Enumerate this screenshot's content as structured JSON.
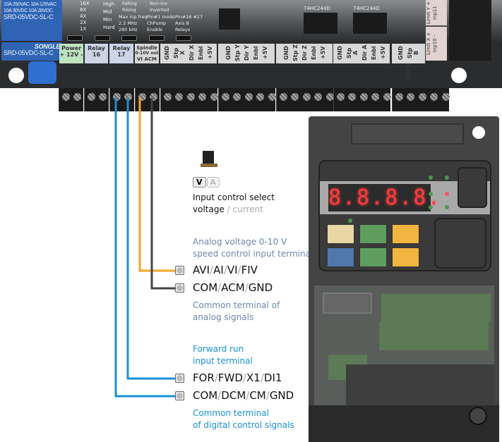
{
  "board": {
    "relay_text": [
      "10A 250VAC  10A 125VAC",
      "10A  30VDC  10A  28VDC",
      "SRD-05VDC-SL-C"
    ],
    "relay_brand": "SONGLE",
    "chip_labels": [
      "74HC244D",
      "74HC244D"
    ],
    "switch_groups": [
      {
        "items": [
          "16X",
          "8X",
          "4X",
          "2X",
          "1X"
        ]
      },
      {
        "items": [
          "High",
          "Mid",
          "Min",
          "Hard"
        ]
      },
      {
        "title": "Max inp freq",
        "items": [
          "Falling",
          "Rising",
          "2.2 MHz",
          "280 kHz"
        ]
      },
      {
        "title": "Pin#1 mode",
        "items": [
          "Non-inv",
          "Inverted",
          "ChPump",
          "Enable"
        ]
      },
      {
        "title": "Pin#16  #17",
        "items": [
          "Axis B",
          "Relays"
        ]
      }
    ],
    "connector_labels": [
      {
        "title": "Power",
        "sub": "+ 12V -"
      },
      {
        "title": "Relay",
        "sub": "16"
      },
      {
        "title": "Relay",
        "sub": "17"
      },
      {
        "title": "Spindle",
        "sub": "0-10V out",
        "sub2": "VI ACM"
      }
    ],
    "axis_groups": [
      [
        "GND",
        "Stp X",
        "Dir X",
        "Enbl",
        "+5V"
      ],
      [
        "GND",
        "Stp Y",
        "Dir Y",
        "Enbl",
        "+5V"
      ],
      [
        "GND",
        "Stp Z",
        "Dir Z",
        "Enbl",
        "+5V"
      ],
      [
        "GND",
        "Stp A",
        "Dir A",
        "Enbl",
        "+5V"
      ],
      [
        "GND",
        "Stp B",
        "Dir B"
      ]
    ],
    "limit_labels": [
      "Limit Y  + inp11",
      "Limit X  + inp10 -"
    ]
  },
  "jumper": {
    "options": [
      "V",
      "A"
    ],
    "selected": "V",
    "caption_line1": "Input control select",
    "caption_selected": "voltage",
    "caption_sep": " / ",
    "caption_other": "current"
  },
  "terminals": [
    {
      "parts": [
        "AVI",
        "AI",
        "VI",
        "FIV"
      ],
      "wire_color": "#f5a623"
    },
    {
      "parts": [
        "COM",
        "ACM",
        "GND"
      ],
      "wire_color": "#444444"
    },
    {
      "parts": [
        "FOR",
        "FWD",
        "X1",
        "DI1"
      ],
      "wire_color": "#1a8fd6"
    },
    {
      "parts": [
        "COM",
        "DCM",
        "CM",
        "GND"
      ],
      "wire_color": "#1a8fd6"
    }
  ],
  "descriptions": {
    "analog_input": [
      "Analog voltage 0-10 V",
      "speed control input terminal"
    ],
    "analog_common": [
      "Common terminal of",
      "analog signals"
    ],
    "forward": [
      "Forward run",
      "input terminal"
    ],
    "digital_common": [
      "Common terminal",
      "of digital control signals"
    ]
  },
  "vfd": {
    "display": "8.8.8.8.",
    "display_color": "#ff3b3b",
    "key_colors": [
      "#e8d6a6",
      "#5f9d5f",
      "#f2b540",
      "#4f78ad",
      "#5f9d5f",
      "#f2b540"
    ]
  }
}
